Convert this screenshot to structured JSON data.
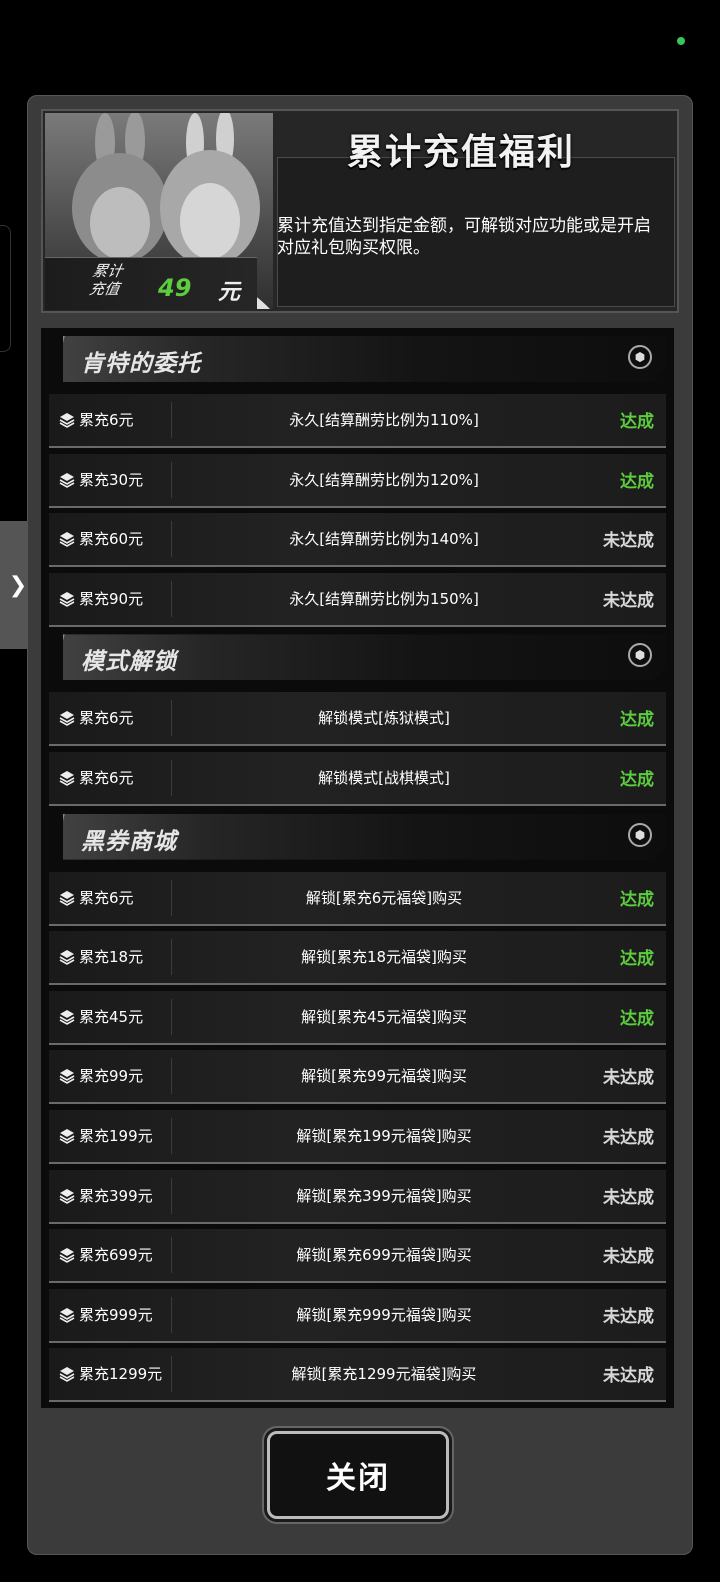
{
  "header": {
    "title": "累计充值福利",
    "description": "累计充值达到指定金额，可解锁对应功能或是开启对应礼包购买权限。",
    "total_label_line1": "累计",
    "total_label_line2": "充值",
    "total_value": "49",
    "total_unit": "元"
  },
  "sections": [
    {
      "title": "肯特的委托",
      "rows": [
        {
          "amount": "累充6元",
          "reward": "永久[结算酬劳比例为110%]",
          "status": "达成",
          "achieved": true
        },
        {
          "amount": "累充30元",
          "reward": "永久[结算酬劳比例为120%]",
          "status": "达成",
          "achieved": true
        },
        {
          "amount": "累充60元",
          "reward": "永久[结算酬劳比例为140%]",
          "status": "未达成",
          "achieved": false
        },
        {
          "amount": "累充90元",
          "reward": "永久[结算酬劳比例为150%]",
          "status": "未达成",
          "achieved": false
        }
      ]
    },
    {
      "title": "模式解锁",
      "rows": [
        {
          "amount": "累充6元",
          "reward": "解锁模式[炼狱模式]",
          "status": "达成",
          "achieved": true
        },
        {
          "amount": "累充6元",
          "reward": "解锁模式[战棋模式]",
          "status": "达成",
          "achieved": true
        }
      ]
    },
    {
      "title": "黑券商城",
      "rows": [
        {
          "amount": "累充6元",
          "reward": "解锁[累充6元福袋]购买",
          "status": "达成",
          "achieved": true
        },
        {
          "amount": "累充18元",
          "reward": "解锁[累充18元福袋]购买",
          "status": "达成",
          "achieved": true
        },
        {
          "amount": "累充45元",
          "reward": "解锁[累充45元福袋]购买",
          "status": "达成",
          "achieved": true
        },
        {
          "amount": "累充99元",
          "reward": "解锁[累充99元福袋]购买",
          "status": "未达成",
          "achieved": false
        },
        {
          "amount": "累充199元",
          "reward": "解锁[累充199元福袋]购买",
          "status": "未达成",
          "achieved": false
        },
        {
          "amount": "累充399元",
          "reward": "解锁[累充399元福袋]购买",
          "status": "未达成",
          "achieved": false
        },
        {
          "amount": "累充699元",
          "reward": "解锁[累充699元福袋]购买",
          "status": "未达成",
          "achieved": false
        },
        {
          "amount": "累充999元",
          "reward": "解锁[累充999元福袋]购买",
          "status": "未达成",
          "achieved": false
        },
        {
          "amount": "累充1299元",
          "reward": "解锁[累充1299元福袋]购买",
          "status": "未达成",
          "achieved": false
        }
      ]
    }
  ],
  "close_label": "关闭",
  "icons": {
    "side_tab": "chevron-right-icon",
    "row": "layers-icon",
    "section": "hexagon-icon"
  },
  "colors": {
    "achieved": "#5ccd3e",
    "not_achieved": "#d8d8d8",
    "total_value": "#5ccd3e"
  }
}
